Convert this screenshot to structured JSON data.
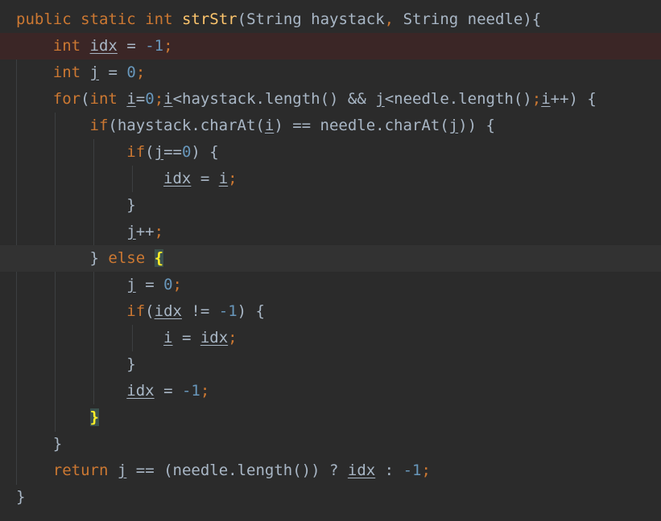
{
  "colors": {
    "background": "#2b2b2b",
    "keyword": "#cc7832",
    "function": "#ffc66d",
    "number": "#6897bb",
    "text": "#a9b7c6",
    "error_line": "#3b2626",
    "brace_match_bg": "#3b514d",
    "brace_match_fg": "#ffef28"
  },
  "code": {
    "l1": {
      "public": "public",
      "static": "static",
      "int": "int",
      "name": "strStr",
      "open": "(",
      "t1": "String",
      "p1": "haystack",
      "comma": ",",
      "t2": "String",
      "p2": "needle",
      "close": "){"
    },
    "l2": {
      "int": "int",
      "var": "idx",
      "eq": "=",
      "num": "-1",
      "semi": ";"
    },
    "l3": {
      "int": "int",
      "var": "j",
      "eq": "=",
      "num": "0",
      "semi": ";"
    },
    "l4": {
      "for": "for",
      "open": "(",
      "int": "int",
      "i": "i",
      "eq": "=",
      "zero": "0",
      "s1": ";",
      "i2": "i",
      "lt": "<haystack.length() && ",
      "j": "j",
      "lt2": "<needle.length()",
      "s2": ";",
      "i3": "i",
      "inc": "++) {"
    },
    "l5": {
      "if": "if",
      "a": "(haystack.charAt(",
      "i": "i",
      "b": ") == needle.charAt(",
      "j": "j",
      "c": ")) {"
    },
    "l6": {
      "if": "if",
      "a": "(",
      "j": "j",
      "b": "==",
      "zero": "0",
      "c": ") {"
    },
    "l7": {
      "idx": "idx",
      "eq": "=",
      "i": "i",
      "semi": ";"
    },
    "l8": {
      "brace": "}"
    },
    "l9": {
      "j": "j",
      "inc": "++",
      "semi": ";"
    },
    "l10": {
      "brace": "}",
      "else": "else",
      "open": "{"
    },
    "l11": {
      "j": "j",
      "eq": "=",
      "zero": "0",
      "semi": ";"
    },
    "l12": {
      "if": "if",
      "a": "(",
      "idx": "idx",
      "ne": "!=",
      "num": "-1",
      "c": ") {"
    },
    "l13": {
      "i": "i",
      "eq": "=",
      "idx": "idx",
      "semi": ";"
    },
    "l14": {
      "brace": "}"
    },
    "l15": {
      "idx": "idx",
      "eq": "=",
      "num": "-1",
      "semi": ";"
    },
    "l16": {
      "brace": "}"
    },
    "l17": {
      "brace": "}"
    },
    "l18": {
      "return": "return",
      "j": "j",
      "a": "== (needle.length()) ?",
      "idx": "idx",
      "b": ":",
      "num": "-1",
      "semi": ";"
    },
    "l19": {
      "brace": "}"
    }
  }
}
